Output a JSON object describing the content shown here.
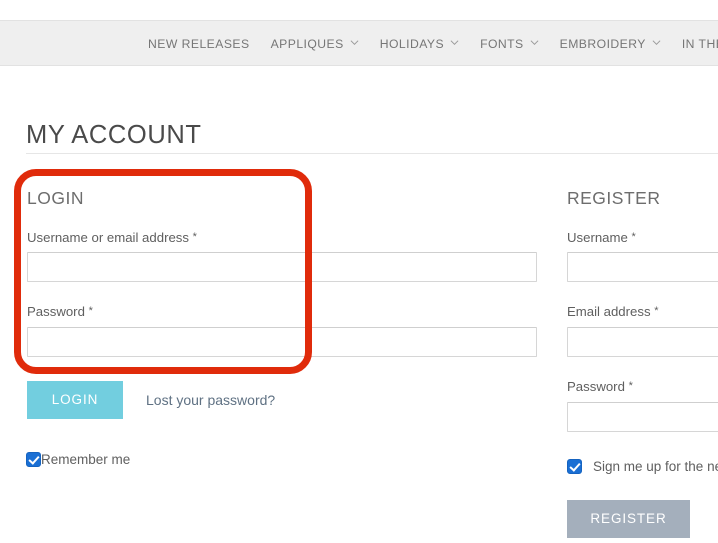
{
  "nav": {
    "items": [
      {
        "label": "NEW RELEASES",
        "has_dropdown": false,
        "icon": ""
      },
      {
        "label": "APPLIQUES",
        "has_dropdown": true,
        "icon": "chevron-down-icon"
      },
      {
        "label": "HOLIDAYS",
        "has_dropdown": true,
        "icon": "chevron-down-icon"
      },
      {
        "label": "FONTS",
        "has_dropdown": true,
        "icon": "chevron-down-icon"
      },
      {
        "label": "EMBROIDERY",
        "has_dropdown": true,
        "icon": "chevron-down-icon"
      },
      {
        "label": "IN THE HOOP",
        "has_dropdown": false,
        "icon": ""
      }
    ]
  },
  "page": {
    "title": "MY ACCOUNT"
  },
  "login": {
    "heading": "LOGIN",
    "username_label": "Username or email address",
    "username_required": "*",
    "username_value": "",
    "username_placeholder": "",
    "password_label": "Password",
    "password_required": "*",
    "password_value": "",
    "password_placeholder": "",
    "button_label": "LOGIN",
    "lost_password_label": "Lost your password?",
    "remember_label": "Remember me",
    "remember_checked": true
  },
  "register": {
    "heading": "REGISTER",
    "username_label": "Username",
    "username_required": "*",
    "username_value": "",
    "username_placeholder": "",
    "email_label": "Email address",
    "email_required": "*",
    "email_value": "",
    "email_placeholder": "",
    "password_label": "Password",
    "password_required": "*",
    "password_value": "",
    "password_placeholder": "",
    "newsletter_label": "Sign me up for the newsletter!",
    "newsletter_checked": true,
    "button_label": "REGISTER"
  },
  "annotation": {
    "color": "#e02b0b",
    "shape": "rounded-rectangle",
    "target": "login-form"
  },
  "colors": {
    "nav_background": "#efefef",
    "nav_text": "#767676",
    "page_background": "#ffffff",
    "heading_text": "#4a4a4a",
    "login_button": "#72cedf",
    "register_button": "#a4afbc",
    "link_text": "#5f7183",
    "input_border": "#d6d6d6",
    "checkbox_accent": "#1a6fd4",
    "annotation_red": "#e02b0b"
  }
}
